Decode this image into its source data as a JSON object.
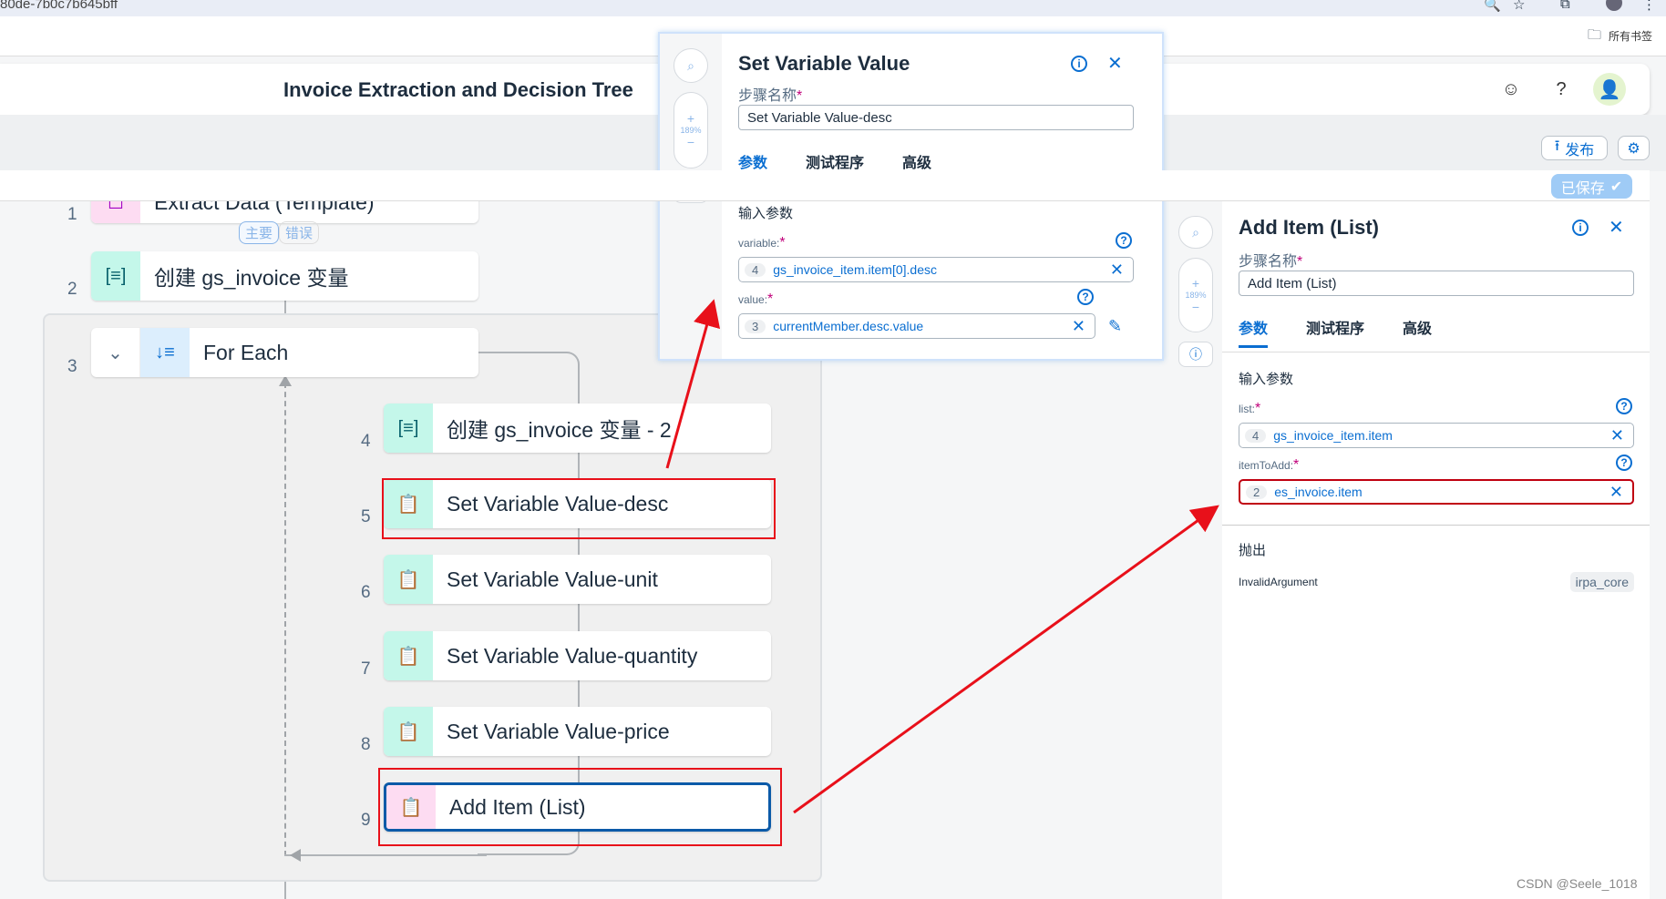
{
  "browser": {
    "url_fragment": "80de-7b0c7b645bff",
    "bookmarks_label": "所有书签"
  },
  "header": {
    "title": "Invoice Extraction and Decision Tree"
  },
  "toolbar": {
    "publish_label": "发布",
    "saved_label": "已保存"
  },
  "canvas": {
    "role_tabs": [
      "主要",
      "错误"
    ],
    "steps": [
      {
        "num": "1",
        "label": "Extract Data (Template)",
        "icon": "extract-icon"
      },
      {
        "num": "2",
        "label": "创建 gs_invoice 变量",
        "icon": "variable-icon"
      },
      {
        "num": "3",
        "label": "For Each",
        "icon": "loop-icon"
      },
      {
        "num": "4",
        "label": "创建 gs_invoice 变量 - 2",
        "icon": "variable-icon"
      },
      {
        "num": "5",
        "label": "Set Variable Value-desc",
        "icon": "clipboard-icon"
      },
      {
        "num": "6",
        "label": "Set Variable Value-unit",
        "icon": "clipboard-icon"
      },
      {
        "num": "7",
        "label": "Set Variable Value-quantity",
        "icon": "clipboard-icon"
      },
      {
        "num": "8",
        "label": "Set Variable Value-price",
        "icon": "clipboard-icon"
      },
      {
        "num": "9",
        "label": "Add Item (List)",
        "icon": "clipboard-icon"
      }
    ]
  },
  "zoom_level": "189%",
  "set_panel": {
    "title": "Set Variable Value",
    "step_name_label": "步骤名称",
    "step_name_value": "Set Variable Value-desc",
    "tabs": [
      "参数",
      "测试程序",
      "高级"
    ],
    "section": "输入参数",
    "params": [
      {
        "label": "variable:",
        "num": "4",
        "value": "gs_invoice_item.item[0].desc"
      },
      {
        "label": "value:",
        "num": "3",
        "value": "currentMember.desc.value"
      }
    ]
  },
  "add_panel": {
    "title": "Add Item (List)",
    "step_name_label": "步骤名称",
    "step_name_value": "Add Item (List)",
    "tabs": [
      "参数",
      "测试程序",
      "高级"
    ],
    "section": "输入参数",
    "params": [
      {
        "label": "list:",
        "num": "4",
        "value": "gs_invoice_item.item"
      },
      {
        "label": "itemToAdd:",
        "num": "2",
        "value": "es_invoice.item"
      }
    ],
    "throws_label": "抛出",
    "throws": [
      {
        "name": "InvalidArgument",
        "module": "irpa_core"
      }
    ]
  },
  "watermark": "CSDN @Seele_1018",
  "colors": {
    "accent": "#0a6ed1",
    "annotation": "#e8101a"
  }
}
